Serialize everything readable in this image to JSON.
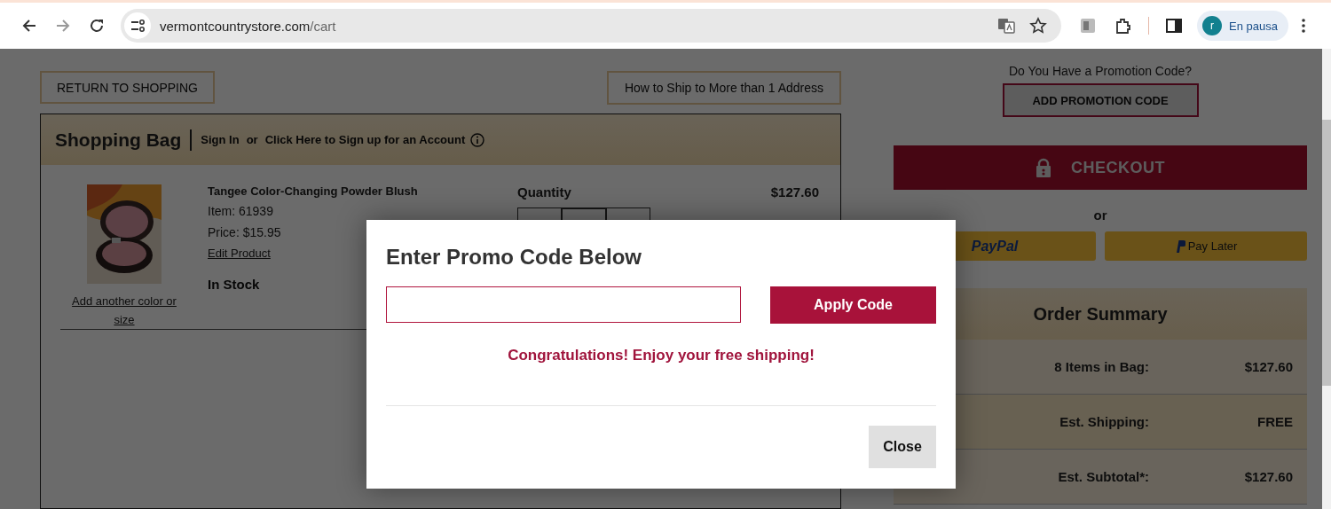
{
  "browser": {
    "url_host": "vermontcountrystore.com",
    "url_path": "/cart",
    "profile_initial": "r",
    "profile_status": "En pausa"
  },
  "page": {
    "return_button": "RETURN TO SHOPPING",
    "ship_button": "How to Ship to More than 1 Address",
    "bag": {
      "title": "Shopping Bag",
      "sign_in": "Sign In",
      "or": "or",
      "sign_up": "Click Here to Sign up for an Account"
    },
    "item": {
      "name": "Tangee Color-Changing Powder Blush",
      "item_no": "Item: 61939",
      "price": "Price: $15.95",
      "edit": "Edit Product",
      "add_another": "Add another color or size",
      "stock": "In Stock",
      "quantity_label": "Quantity",
      "total": "$127.60"
    },
    "promo": {
      "question": "Do You Have a Promotion Code?",
      "button": "ADD PROMOTION CODE"
    },
    "checkout": "CHECKOUT",
    "or": "or",
    "paypal": "PayPal",
    "pay_later": "Pay Later",
    "summary": {
      "title": "Order Summary",
      "rows": [
        {
          "label": "8 Items in Bag:",
          "value": "$127.60"
        },
        {
          "label": "Est. Shipping:",
          "value": "FREE"
        },
        {
          "label": "Est. Subtotal*:",
          "value": "$127.60"
        }
      ]
    }
  },
  "modal": {
    "title": "Enter Promo Code Below",
    "apply": "Apply Code",
    "message": "Congratulations! Enjoy your free shipping!",
    "close": "Close"
  }
}
